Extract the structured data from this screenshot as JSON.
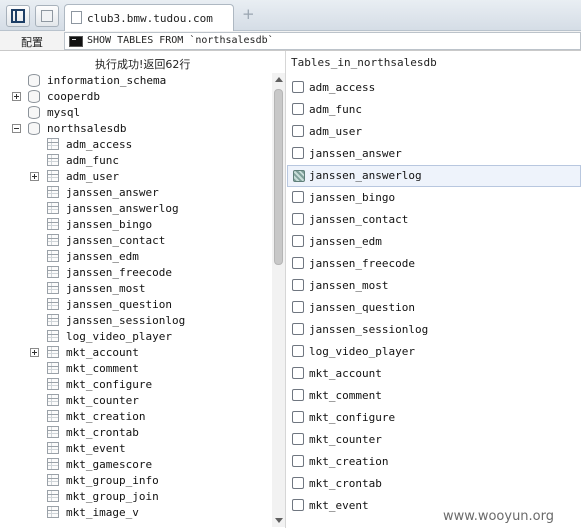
{
  "tab": {
    "title": "club3.bmw.tudou.com"
  },
  "address": {
    "label": "配置",
    "query": "SHOW TABLES FROM `northsalesdb`"
  },
  "left": {
    "status": "执行成功!返回62行",
    "databases": [
      {
        "name": "information_schema",
        "expandable": false
      },
      {
        "name": "cooperdb",
        "expandable": true,
        "state": "collapsed"
      },
      {
        "name": "mysql",
        "expandable": false
      },
      {
        "name": "northsalesdb",
        "expandable": true,
        "state": "expanded"
      }
    ],
    "tables": [
      {
        "name": "adm_access",
        "expandable": false
      },
      {
        "name": "adm_func",
        "expandable": false
      },
      {
        "name": "adm_user",
        "expandable": true
      },
      {
        "name": "janssen_answer",
        "expandable": false
      },
      {
        "name": "janssen_answerlog",
        "expandable": false
      },
      {
        "name": "janssen_bingo",
        "expandable": false
      },
      {
        "name": "janssen_contact",
        "expandable": false
      },
      {
        "name": "janssen_edm",
        "expandable": false
      },
      {
        "name": "janssen_freecode",
        "expandable": false
      },
      {
        "name": "janssen_most",
        "expandable": false
      },
      {
        "name": "janssen_question",
        "expandable": false
      },
      {
        "name": "janssen_sessionlog",
        "expandable": false
      },
      {
        "name": "log_video_player",
        "expandable": false
      },
      {
        "name": "mkt_account",
        "expandable": true
      },
      {
        "name": "mkt_comment",
        "expandable": false
      },
      {
        "name": "mkt_configure",
        "expandable": false
      },
      {
        "name": "mkt_counter",
        "expandable": false
      },
      {
        "name": "mkt_creation",
        "expandable": false
      },
      {
        "name": "mkt_crontab",
        "expandable": false
      },
      {
        "name": "mkt_event",
        "expandable": false
      },
      {
        "name": "mkt_gamescore",
        "expandable": false
      },
      {
        "name": "mkt_group_info",
        "expandable": false
      },
      {
        "name": "mkt_group_join",
        "expandable": false
      },
      {
        "name": "mkt_image_v",
        "expandable": false
      }
    ]
  },
  "right": {
    "header": "Tables_in_northsalesdb",
    "selected_index": 4,
    "rows": [
      "adm_access",
      "adm_func",
      "adm_user",
      "janssen_answer",
      "janssen_answerlog",
      "janssen_bingo",
      "janssen_contact",
      "janssen_edm",
      "janssen_freecode",
      "janssen_most",
      "janssen_question",
      "janssen_sessionlog",
      "log_video_player",
      "mkt_account",
      "mkt_comment",
      "mkt_configure",
      "mkt_counter",
      "mkt_creation",
      "mkt_crontab",
      "mkt_event"
    ]
  },
  "watermark": "www.wooyun.org"
}
